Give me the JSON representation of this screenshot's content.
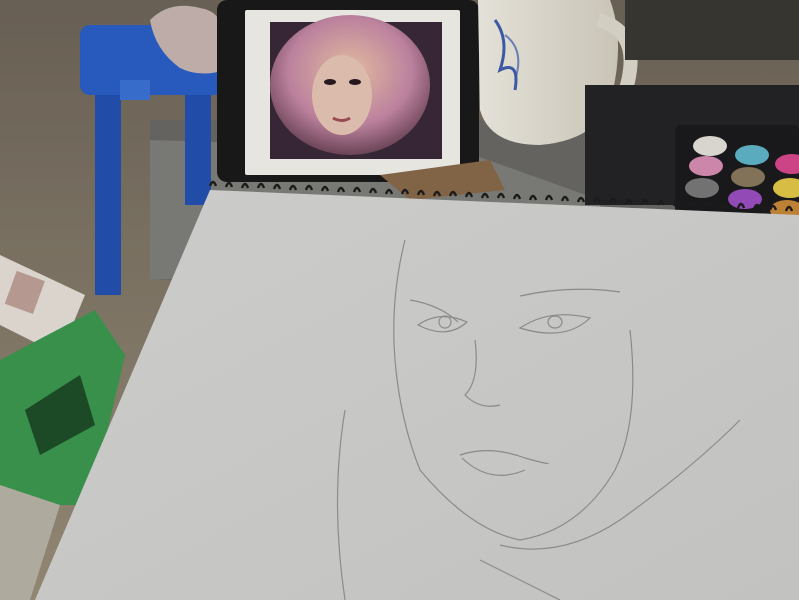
{
  "scene": {
    "label": "",
    "objects": [
      "wooden-floor",
      "blue-plastic-stool",
      "green-plastic-stool",
      "cloth",
      "tablet",
      "portrait-photo",
      "white-kettle",
      "eyeshadow-palette",
      "spiral-sketchbook",
      "pencil-sketch"
    ]
  },
  "palette": {
    "floor": "#8c826f",
    "blue_stool": "#2b5fc8",
    "green_stool": "#3c9a4f",
    "paper": "#d8d8d6",
    "kettle": "#e8e4d8",
    "tablet": "#1a1a1a",
    "eyeshadow": [
      "#e6e3dc",
      "#5fb6c9",
      "#d9488f",
      "#d98fb4",
      "#8a7a5e",
      "#e6c94a",
      "#7a7a7a",
      "#9b4fc2",
      "#c98a3a"
    ]
  }
}
